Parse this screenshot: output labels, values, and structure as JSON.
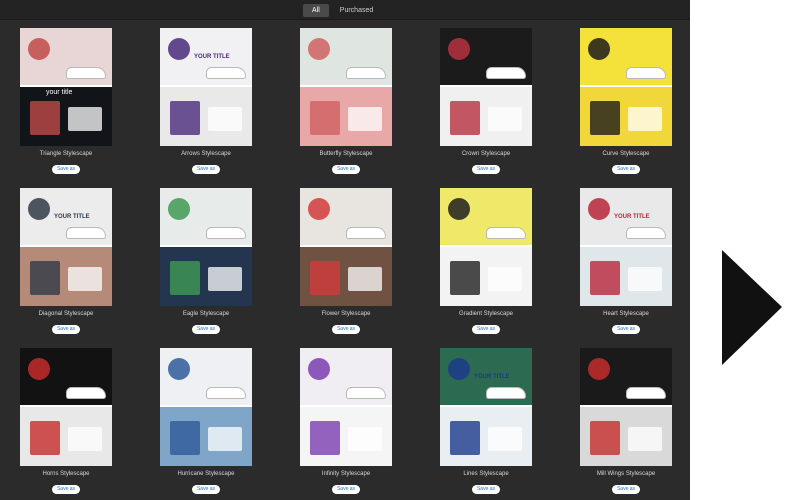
{
  "tabs": [
    {
      "label": "All",
      "active": true
    },
    {
      "label": "Purchased",
      "active": false
    }
  ],
  "save_label": "Save as",
  "cards": [
    {
      "title": "Triangle Stylescape",
      "top": "#e8d5d5",
      "bottom": "#111418",
      "accent": "#c24a4a",
      "top_text": "",
      "bottom_text": "your title"
    },
    {
      "title": "Arrows Stylescape",
      "top": "#f1f1f3",
      "bottom": "#e9e9e9",
      "accent": "#4a2a7a",
      "top_text": "YOUR TITLE",
      "bottom_text": ""
    },
    {
      "title": "Butterfly Stylescape",
      "top": "#dfe6e2",
      "bottom": "#e8a8a8",
      "accent": "#d06060",
      "top_text": "",
      "bottom_text": ""
    },
    {
      "title": "Crown Stylescape",
      "top": "#1b1b1b",
      "bottom": "#f0f0f0",
      "accent": "#b63040",
      "top_text": "",
      "bottom_text": ""
    },
    {
      "title": "Curve Stylescape",
      "top": "#f4e23a",
      "bottom": "#f2d73b",
      "accent": "#1b1b1b",
      "top_text": "",
      "bottom_text": ""
    },
    {
      "title": "Diagonal Stylescape",
      "top": "#ececec",
      "bottom": "#b58a78",
      "accent": "#2f3a46",
      "top_text": "YOUR TITLE",
      "bottom_text": ""
    },
    {
      "title": "Eagle Stylescape",
      "top": "#e7ebea",
      "bottom": "#24354f",
      "accent": "#3f9a55",
      "top_text": "",
      "bottom_text": ""
    },
    {
      "title": "Flower Stylescape",
      "top": "#e8e4df",
      "bottom": "#6f5242",
      "accent": "#d23b3b",
      "top_text": "",
      "bottom_text": ""
    },
    {
      "title": "Gradient Stylescape",
      "top": "#efe96a",
      "bottom": "#f3f3f3",
      "accent": "#1f1f1f",
      "top_text": "",
      "bottom_text": ""
    },
    {
      "title": "Heart Stylescape",
      "top": "#e9e9e9",
      "bottom": "#dfe7ea",
      "accent": "#b8263a",
      "top_text": "YOUR TITLE",
      "bottom_text": ""
    },
    {
      "title": "Horns Stylescape",
      "top": "#121212",
      "bottom": "#e8e8e8",
      "accent": "#c72b2b",
      "top_text": "",
      "bottom_text": ""
    },
    {
      "title": "Hurricane Stylescape",
      "top": "#eef0f3",
      "bottom": "#7fa6c9",
      "accent": "#2e5a9a",
      "top_text": "",
      "bottom_text": ""
    },
    {
      "title": "Infinity Stylescape",
      "top": "#f0eef2",
      "bottom": "#f5f5f5",
      "accent": "#7a3db0",
      "top_text": "",
      "bottom_text": ""
    },
    {
      "title": "Lines Stylescape",
      "top": "#2d6a52",
      "bottom": "#e9eef2",
      "accent": "#1b3a8a",
      "top_text": "YOUR TITLE",
      "bottom_text": ""
    },
    {
      "title": "Mill Wings Stylescape",
      "top": "#1a1a1a",
      "bottom": "#d9d9d9",
      "accent": "#c62d2d",
      "top_text": "",
      "bottom_text": ""
    }
  ]
}
